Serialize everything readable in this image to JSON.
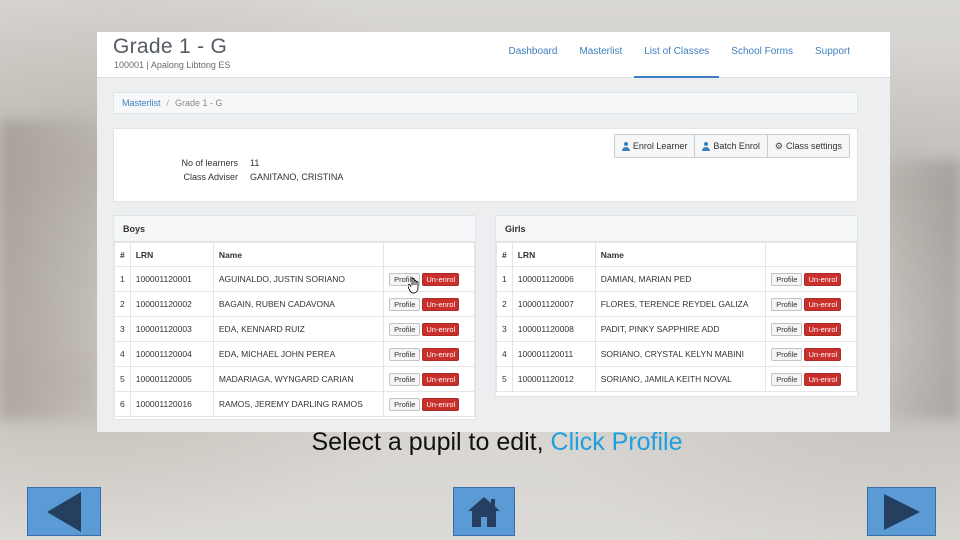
{
  "header": {
    "title": "Grade 1 - G",
    "subtitle": "100001 | Apalong Libtong ES",
    "nav": [
      {
        "label": "Dashboard",
        "active": false
      },
      {
        "label": "Masterlist",
        "active": false
      },
      {
        "label": "List of Classes",
        "active": true
      },
      {
        "label": "School Forms",
        "active": false
      },
      {
        "label": "Support",
        "active": false
      }
    ]
  },
  "breadcrumb": {
    "link": "Masterlist",
    "separator": "/",
    "current": "Grade 1 - G"
  },
  "class_info": {
    "learners_label": "No of learners",
    "learners_value": "11",
    "adviser_label": "Class Adviser",
    "adviser_value": "GANITANO, CRISTINA",
    "actions": {
      "enrol_learner": "Enrol Learner",
      "batch_enrol": "Batch Enrol",
      "class_settings": "Class settings"
    }
  },
  "table_headers": {
    "no": "#",
    "lrn": "LRN",
    "name": "Name"
  },
  "row_actions": {
    "profile": "Profile",
    "unenrol": "Un-enrol"
  },
  "boys": {
    "title": "Boys",
    "rows": [
      {
        "no": "1",
        "lrn": "100001120001",
        "name": "AGUINALDO, JUSTIN SORIANO"
      },
      {
        "no": "2",
        "lrn": "100001120002",
        "name": "BAGAIN, RUBEN CADAVONA"
      },
      {
        "no": "3",
        "lrn": "100001120003",
        "name": "EDA, KENNARD RUIZ"
      },
      {
        "no": "4",
        "lrn": "100001120004",
        "name": "EDA, MICHAEL JOHN PEREA"
      },
      {
        "no": "5",
        "lrn": "100001120005",
        "name": "MADARIAGA, WYNGARD CARIAN"
      },
      {
        "no": "6",
        "lrn": "100001120016",
        "name": "RAMOS, JEREMY DARLING RAMOS"
      }
    ]
  },
  "girls": {
    "title": "Girls",
    "rows": [
      {
        "no": "1",
        "lrn": "100001120006",
        "name": "DAMIAN, MARIAN PED"
      },
      {
        "no": "2",
        "lrn": "100001120007",
        "name": "FLORES, TERENCE REYDEL GALIZA"
      },
      {
        "no": "3",
        "lrn": "100001120008",
        "name": "PADIT, PINKY SAPPHIRE ADD"
      },
      {
        "no": "4",
        "lrn": "100001120011",
        "name": "SORIANO, CRYSTAL KELYN MABINI"
      },
      {
        "no": "5",
        "lrn": "100001120012",
        "name": "SORIANO, JAMILA KEITH NOVAL"
      }
    ]
  },
  "caption": {
    "text": "Select a pupil to edit, ",
    "highlight": "Click Profile"
  },
  "colors": {
    "accent": "#3f7fbf",
    "danger": "#c9302c",
    "caption_highlight": "#1f9fe0",
    "nav_button": "#5b9bd5"
  },
  "icons": {
    "prev": "triangle-left-icon",
    "home": "house-icon",
    "next": "triangle-right-icon"
  }
}
